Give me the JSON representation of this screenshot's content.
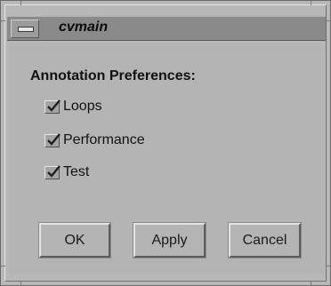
{
  "window": {
    "title": "cvmain",
    "menu_icon": "window-menu-icon"
  },
  "dialog": {
    "heading": "Annotation Preferences:",
    "checkboxes": [
      {
        "label": "Loops",
        "checked": true,
        "icon": "checkmark-icon"
      },
      {
        "label": "Performance",
        "checked": true,
        "icon": "checkmark-icon"
      },
      {
        "label": "Test",
        "checked": true,
        "icon": "checkmark-icon"
      }
    ],
    "buttons": {
      "ok": "OK",
      "apply": "Apply",
      "cancel": "Cancel"
    }
  }
}
